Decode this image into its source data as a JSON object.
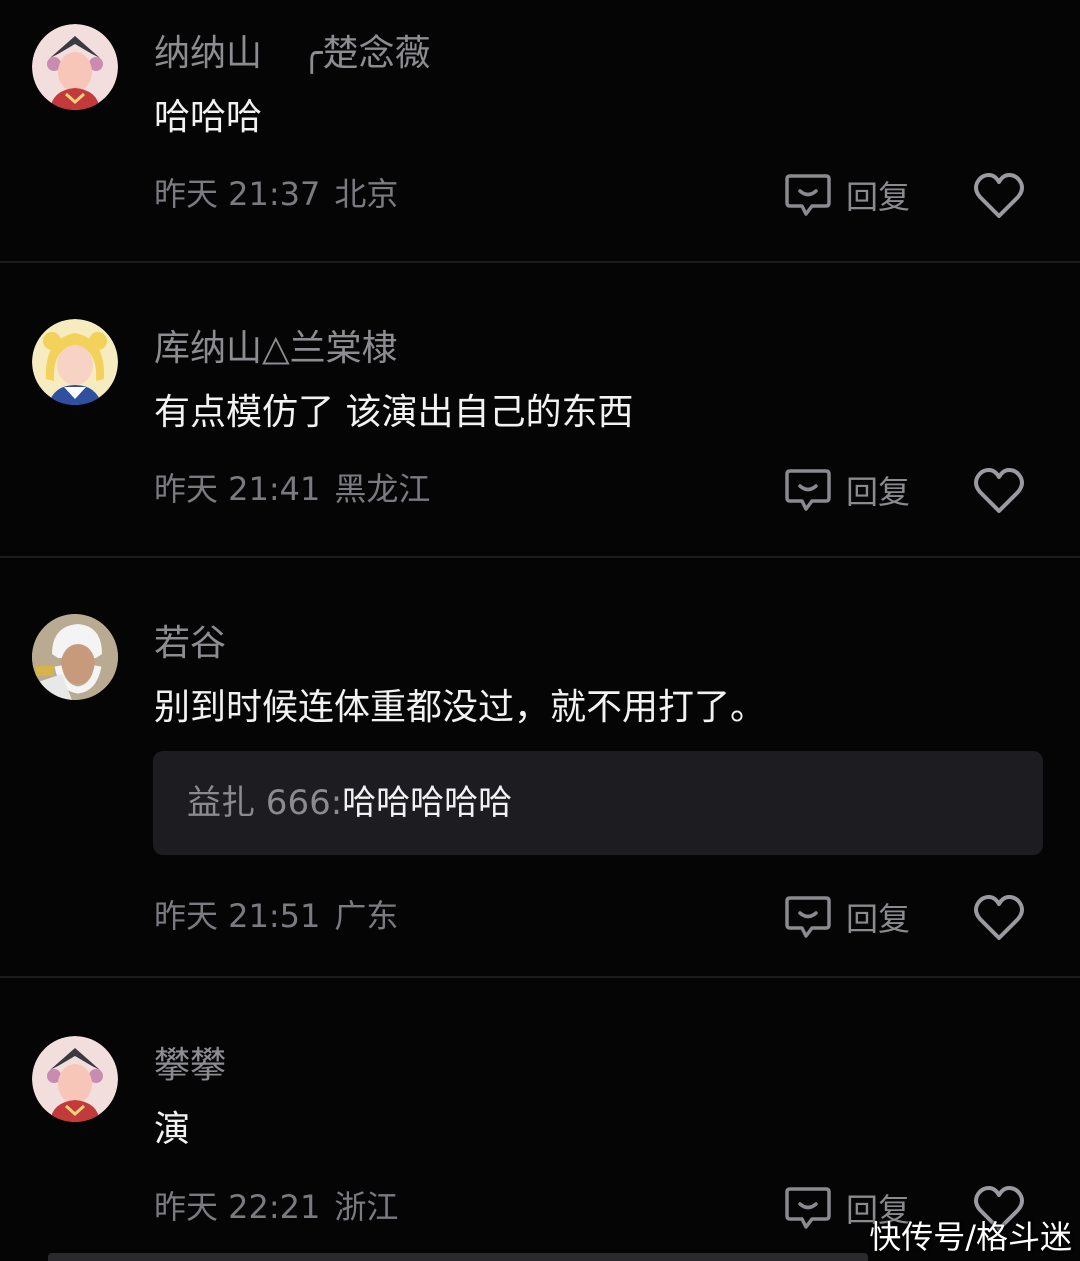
{
  "comments": [
    {
      "username": "纳纳山",
      "username_extra": "╭楚念薇",
      "text": "哈哈哈",
      "time": "昨天 21:37",
      "location": "北京",
      "reply_label": "回复"
    },
    {
      "username": "库纳山△兰棠棣",
      "text": "有点模仿了 该演出自己的东西",
      "time": "昨天 21:41",
      "location": "黑龙江",
      "reply_label": "回复"
    },
    {
      "username": "若谷",
      "text": "别到时候连体重都没过，就不用打了。",
      "quote_author": "益扎 666:",
      "quote_text": "哈哈哈哈哈",
      "time": "昨天 21:51",
      "location": "广东",
      "reply_label": "回复"
    },
    {
      "username": "攀攀",
      "text": "演",
      "time": "昨天 22:21",
      "location": "浙江",
      "reply_label": "回复"
    }
  ],
  "watermark": "快传号/格斗迷",
  "icons": {
    "reply": "comment-bubble-icon",
    "like": "heart-outline-icon"
  },
  "colors": {
    "background": "#050506",
    "username": "#8c8c91",
    "meta": "#7a7a80",
    "quote_bg": "#1d1d21"
  }
}
